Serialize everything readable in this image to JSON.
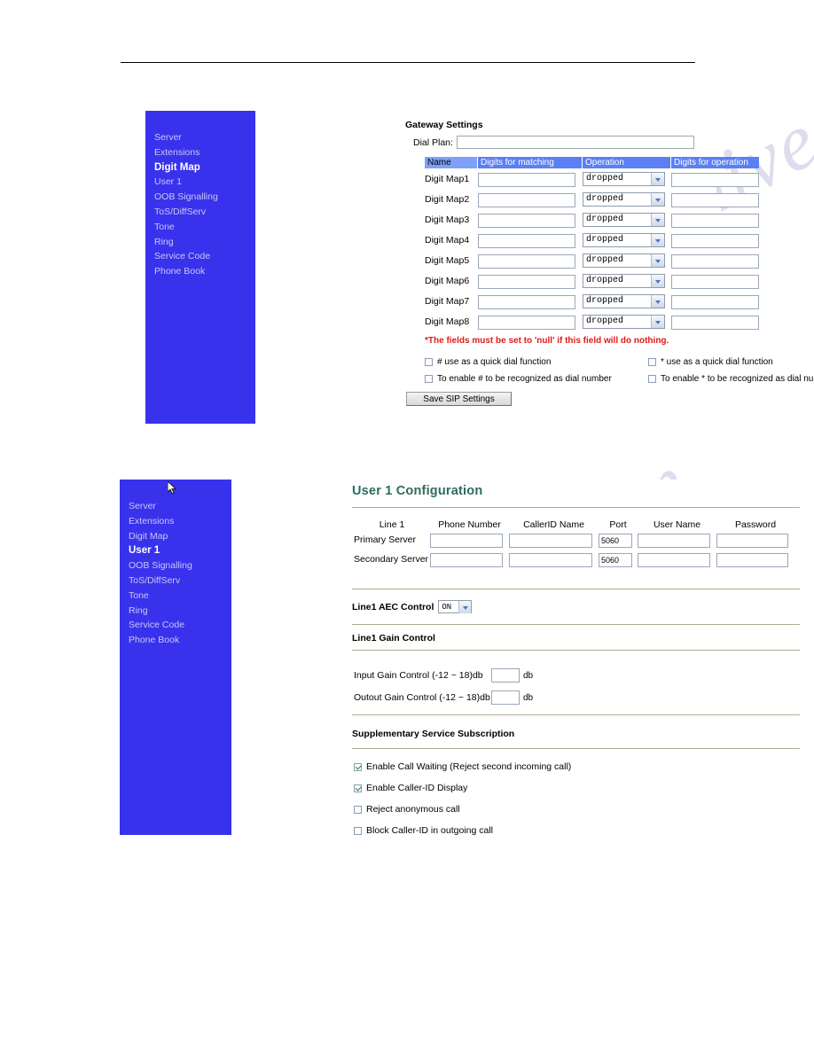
{
  "watermark": {
    "text": "manualshive.com"
  },
  "panel_digitmap": {
    "sidebar": {
      "items": [
        {
          "label": "Server",
          "active": false
        },
        {
          "label": "Extensions",
          "active": false
        },
        {
          "label": "Digit Map",
          "active": true
        },
        {
          "label": "User 1",
          "active": false
        },
        {
          "label": "OOB Signalling",
          "active": false
        },
        {
          "label": "ToS/DiffServ",
          "active": false
        },
        {
          "label": "Tone",
          "active": false
        },
        {
          "label": "Ring",
          "active": false
        },
        {
          "label": "Service Code",
          "active": false
        },
        {
          "label": "Phone Book",
          "active": false
        }
      ]
    },
    "title": "Gateway Settings",
    "dial_plan": {
      "label": "Dial Plan:",
      "value": ""
    },
    "table": {
      "headers": [
        "Name",
        "Digits for matching",
        "Operation",
        "Digits for operation"
      ],
      "rows": [
        {
          "name": "Digit Map1",
          "matching": "",
          "operation": "dropped",
          "operation_digits": ""
        },
        {
          "name": "Digit Map2",
          "matching": "",
          "operation": "dropped",
          "operation_digits": ""
        },
        {
          "name": "Digit Map3",
          "matching": "",
          "operation": "dropped",
          "operation_digits": ""
        },
        {
          "name": "Digit Map4",
          "matching": "",
          "operation": "dropped",
          "operation_digits": ""
        },
        {
          "name": "Digit Map5",
          "matching": "",
          "operation": "dropped",
          "operation_digits": ""
        },
        {
          "name": "Digit Map6",
          "matching": "",
          "operation": "dropped",
          "operation_digits": ""
        },
        {
          "name": "Digit Map7",
          "matching": "",
          "operation": "dropped",
          "operation_digits": ""
        },
        {
          "name": "Digit Map8",
          "matching": "",
          "operation": "dropped",
          "operation_digits": ""
        }
      ]
    },
    "warning": "*The fields must be set to 'null' if this field will do nothing.",
    "checkboxes": [
      {
        "label": "# use as a quick dial function",
        "checked": false
      },
      {
        "label": "* use as a quick dial function",
        "checked": false
      },
      {
        "label": "To enable # to be recognized as dial number",
        "checked": false
      },
      {
        "label": "To enable * to be recognized as dial number",
        "checked": false
      }
    ],
    "save_button": "Save SIP Settings",
    "colors": {
      "sidebar": "#3832ec",
      "header": "#5b7ff5",
      "warning": "#e01b1b"
    }
  },
  "panel_user1": {
    "sidebar": {
      "items": [
        {
          "label": "Server",
          "active": false
        },
        {
          "label": "Extensions",
          "active": false
        },
        {
          "label": "Digit Map",
          "active": false
        },
        {
          "label": "User 1",
          "active": true
        },
        {
          "label": "OOB Signalling",
          "active": false
        },
        {
          "label": "ToS/DiffServ",
          "active": false
        },
        {
          "label": "Tone",
          "active": false
        },
        {
          "label": "Ring",
          "active": false
        },
        {
          "label": "Service Code",
          "active": false
        },
        {
          "label": "Phone Book",
          "active": false
        }
      ]
    },
    "title": "User 1 Configuration",
    "server_table": {
      "headers": [
        "Line 1",
        "Phone Number",
        "CallerID Name",
        "Port",
        "User Name",
        "Password"
      ],
      "rows": [
        {
          "name": "Primary Server",
          "phone": "",
          "callerid": "",
          "port": "5060",
          "user": "",
          "password": ""
        },
        {
          "name": "Secondary Server",
          "phone": "",
          "callerid": "",
          "port": "5060",
          "user": "",
          "password": ""
        }
      ]
    },
    "aec": {
      "label": "Line1 AEC Control",
      "value": "ON"
    },
    "gain": {
      "title": "Line1 Gain Control",
      "rows": [
        {
          "label": "Input Gain Control (-12 ~ 18)db",
          "value": "",
          "unit": "db"
        },
        {
          "label": "Outout Gain Control (-12 ~ 18)db",
          "value": "",
          "unit": "db"
        }
      ]
    },
    "supplementary": {
      "title": "Supplementary Service Subscription",
      "checkboxes": [
        {
          "label": "Enable Call Waiting (Reject second incoming call)",
          "checked": true
        },
        {
          "label": "Enable Caller-ID Display",
          "checked": true
        },
        {
          "label": "Reject anonymous call",
          "checked": false
        },
        {
          "label": "Block Caller-ID in outgoing call",
          "checked": false
        }
      ]
    },
    "colors": {
      "sidebar": "#3832ec",
      "title": "#2e6b5e"
    }
  }
}
